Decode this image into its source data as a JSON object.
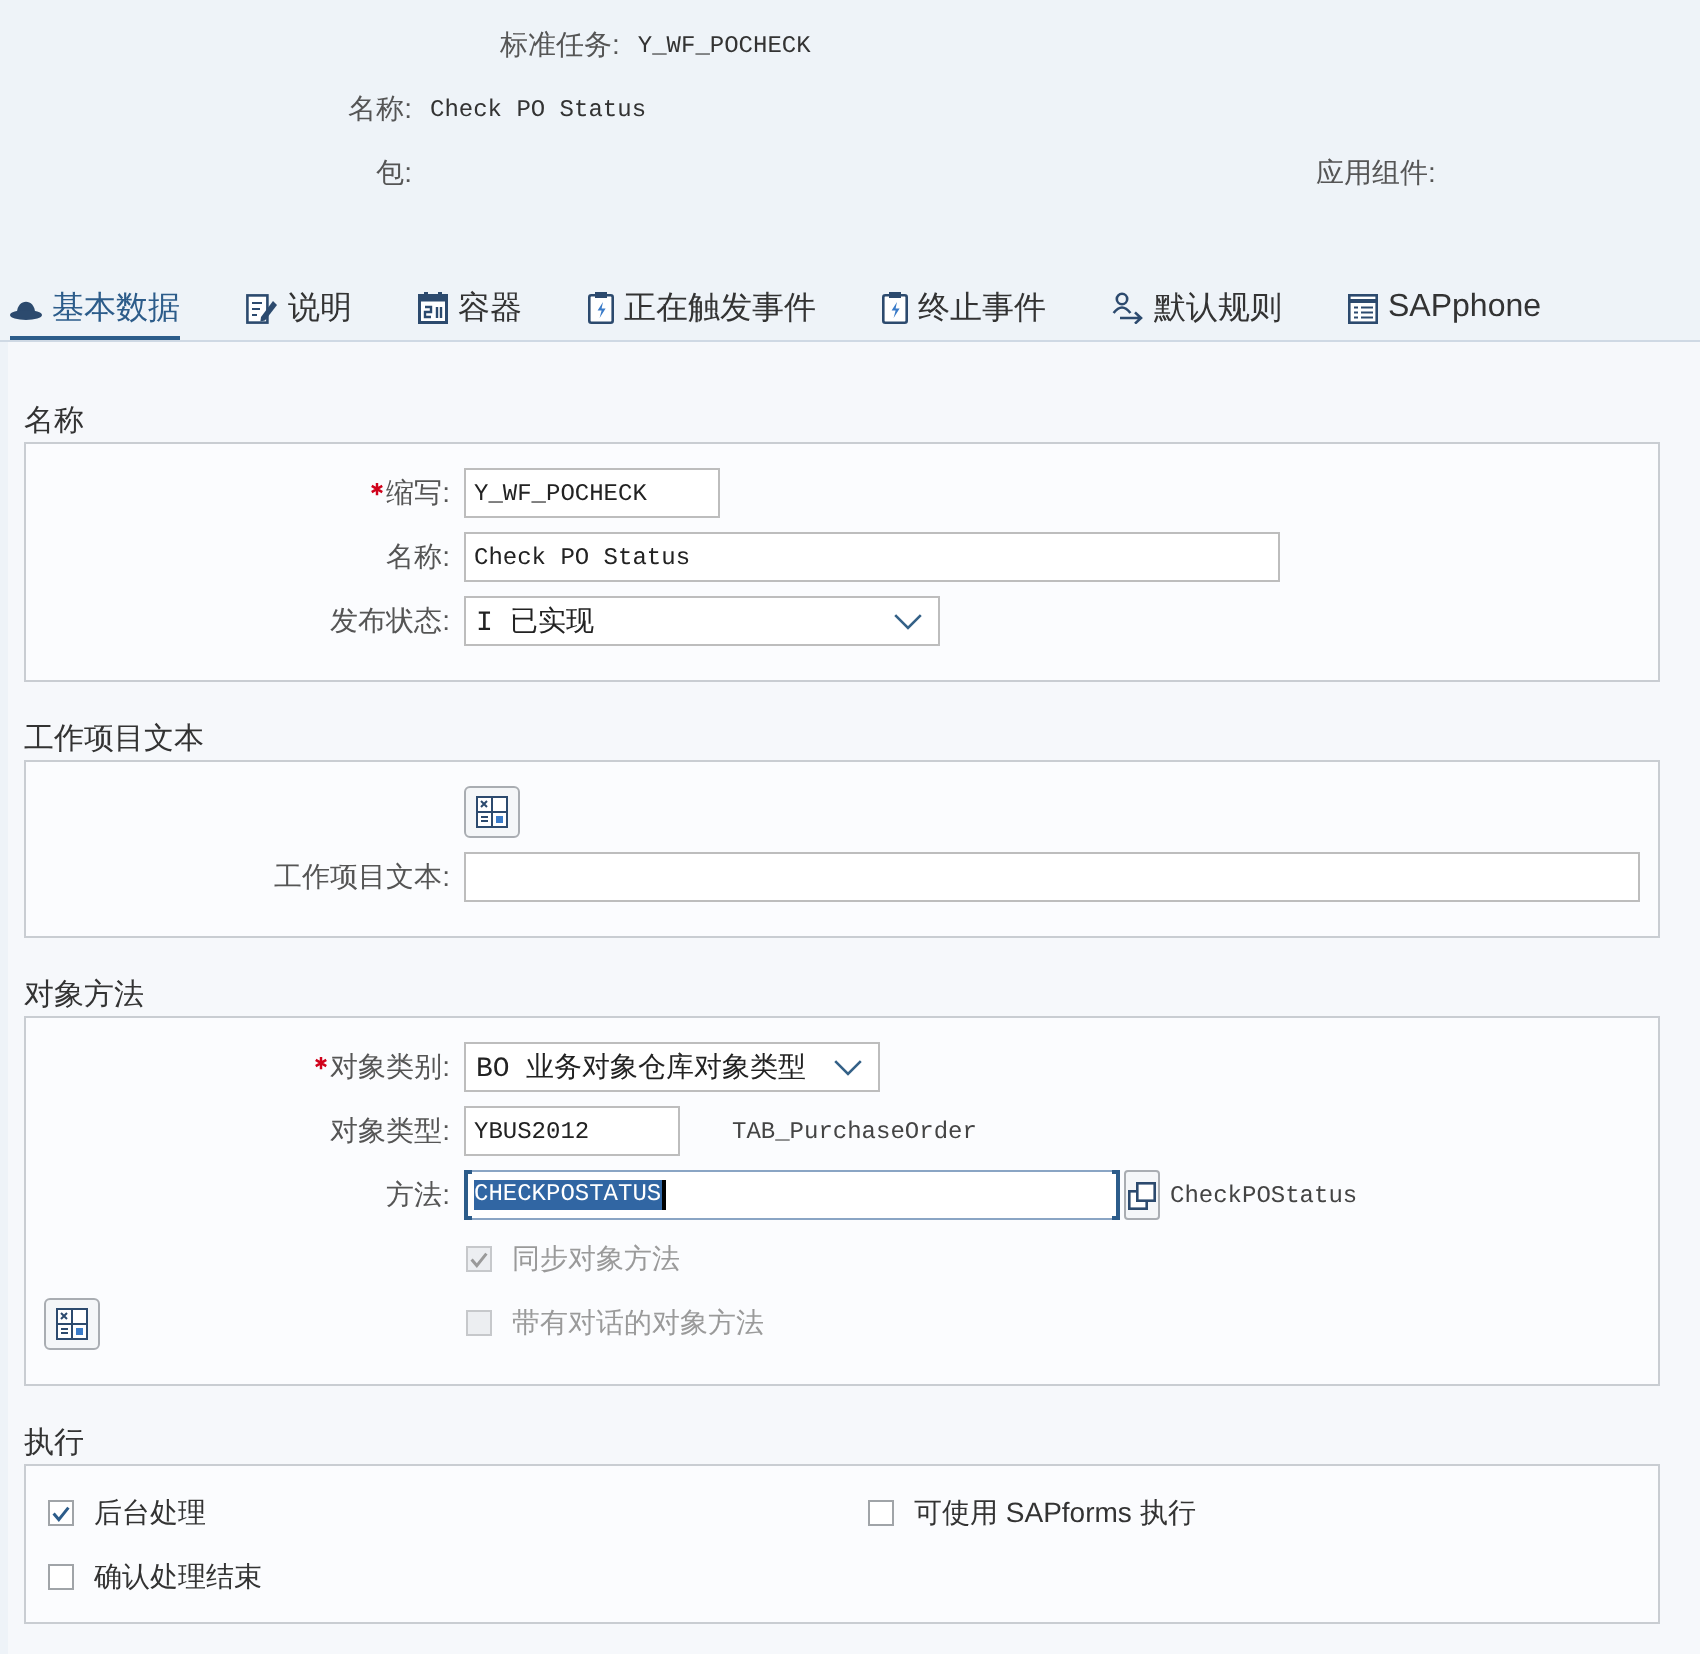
{
  "header": {
    "standard_task": {
      "label": "标准任务:",
      "value": "Y_WF_POCHECK"
    },
    "name": {
      "label": "名称:",
      "value": "Check PO Status"
    },
    "package": {
      "label": "包:"
    },
    "application_component": {
      "label": "应用组件:"
    }
  },
  "tabs": [
    {
      "label": "基本数据",
      "selected": true
    },
    {
      "label": "说明",
      "selected": false
    },
    {
      "label": "容器",
      "selected": false
    },
    {
      "label": "正在触发事件",
      "selected": false
    },
    {
      "label": "终止事件",
      "selected": false
    },
    {
      "label": "默认规则",
      "selected": false
    },
    {
      "label": "SAPphone",
      "selected": false
    }
  ],
  "name_section": {
    "title": "名称",
    "abbreviation": {
      "label": "缩写:",
      "required": true,
      "value": "Y_WF_POCHECK"
    },
    "name": {
      "label": "名称:",
      "required": false,
      "value": "Check PO Status"
    },
    "release_status": {
      "label": "发布状态:",
      "required": false,
      "value": "I 已实现"
    }
  },
  "work_item_text": {
    "title": "工作项目文本",
    "field": {
      "label": "工作项目文本:",
      "required": false
    }
  },
  "object_method": {
    "title": "对象方法",
    "object_category": {
      "label": "对象类别:",
      "required": true,
      "value": "BO 业务对象仓库对象类型"
    },
    "object_type": {
      "label": "对象类型:",
      "required": false,
      "value": "YBUS2012",
      "description": "TAB_PurchaseOrder"
    },
    "method": {
      "label": "方法:",
      "required": false,
      "value": "CHECKPOSTATUS",
      "focused": true,
      "text_selected": true,
      "description": "CheckPOStatus"
    },
    "options": [
      {
        "label": "同步对象方法",
        "checked": true,
        "disabled": true
      },
      {
        "label": "带有对话的对象方法",
        "checked": false,
        "disabled": true
      }
    ]
  },
  "execution": {
    "title": "执行",
    "options": [
      {
        "label": "后台处理",
        "checked": true,
        "disabled": false
      },
      {
        "label": "可使用 SAPforms 执行",
        "checked": false,
        "disabled": false
      },
      {
        "label": "确认处理结束",
        "checked": false,
        "disabled": false
      }
    ]
  }
}
